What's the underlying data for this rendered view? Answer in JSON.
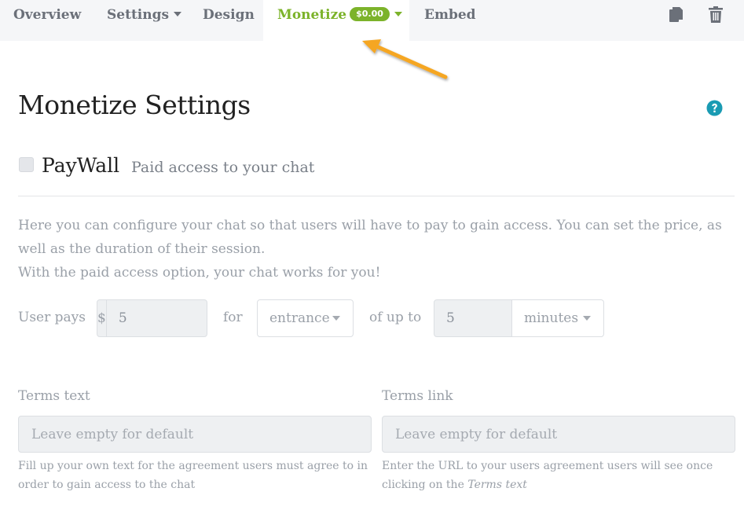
{
  "tabs": [
    {
      "label": "Overview"
    },
    {
      "label": "Settings"
    },
    {
      "label": "Design"
    },
    {
      "label": "Monetize",
      "badge": "$0.00"
    },
    {
      "label": "Embed"
    }
  ],
  "icons": {
    "copy": "copy-icon",
    "trash": "trash-icon",
    "help": "help-circle-icon"
  },
  "colors": {
    "accent": "#7cb32a",
    "help": "#1a9bb3",
    "arrow": "#f5a623"
  },
  "page_title": "Monetize Settings",
  "paywall": {
    "title": "PayWall",
    "subtitle": "Paid access to your chat",
    "checked": false
  },
  "description": {
    "line1": "Here you can configure your chat so that users will have to pay to gain access. You can set the price, as well as the duration of their session.",
    "line2": "With the paid access option, your chat works for you!"
  },
  "pricing": {
    "user_pays_label": "User pays",
    "currency": "$",
    "price": "5",
    "for_label": "for",
    "access_type": "entrance",
    "of_up_to_label": "of up to",
    "duration": "5",
    "duration_unit": "minutes"
  },
  "terms": {
    "text_label": "Terms text",
    "text_placeholder": "Leave empty for default",
    "text_hint": "Fill up your own text for the agreement users must agree to in order to gain access to the chat",
    "link_label": "Terms link",
    "link_placeholder": "Leave empty for default",
    "link_hint_prefix": "Enter the URL to your users agreement users will see once clicking on the",
    "link_hint_em": "Terms text"
  }
}
